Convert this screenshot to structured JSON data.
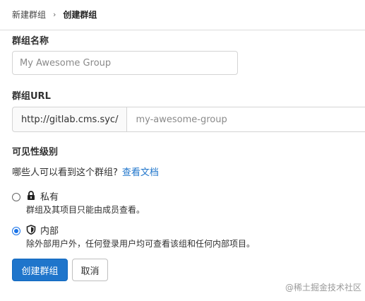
{
  "breadcrumb": {
    "parent": "新建群组",
    "separator": "›",
    "current": "创建群组"
  },
  "group_name": {
    "label": "群组名称",
    "placeholder": "My Awesome Group",
    "value": ""
  },
  "group_url": {
    "label": "群组URL",
    "prefix": "http://gitlab.cms.syc/",
    "placeholder": "my-awesome-group",
    "value": ""
  },
  "visibility": {
    "label": "可见性级别",
    "help_text": "哪些人可以看到这个群组?",
    "doc_link": "查看文档",
    "options": [
      {
        "title": "私有",
        "description": "群组及其项目只能由成员查看。",
        "icon": "lock-icon",
        "selected": false
      },
      {
        "title": "内部",
        "description": "除外部用户外，任何登录用户均可查看该组和任何内部项目。",
        "icon": "shield-icon",
        "selected": true
      }
    ]
  },
  "actions": {
    "create": "创建群组",
    "cancel": "取消"
  },
  "colors": {
    "primary": "#1f75cb",
    "link": "#1f75cb",
    "radio_checked": "#1a73e8"
  },
  "watermark": "@稀土掘金技术社区"
}
